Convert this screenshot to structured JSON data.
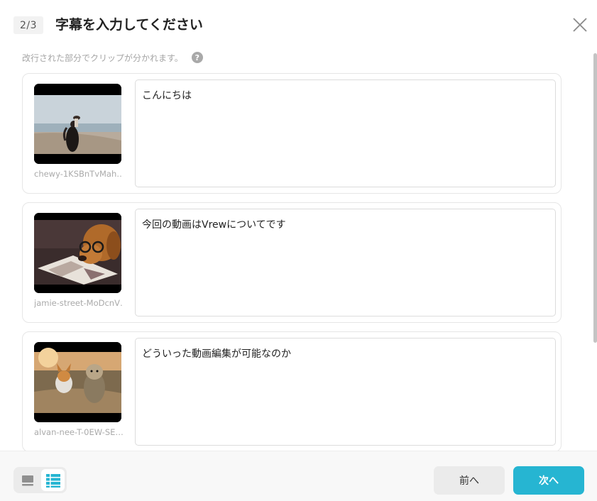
{
  "header": {
    "step": "2/3",
    "title": "字幕を入力してください"
  },
  "hint": {
    "text": "改行された部分でクリップが分かれます。",
    "help_glyph": "?"
  },
  "clips": [
    {
      "name": "chewy-1KSBnTvMah…",
      "caption": "こんにちは"
    },
    {
      "name": "jamie-street-MoDcnV…",
      "caption": "今回の動画はVrewについてです"
    },
    {
      "name": "alvan-nee-T-0EW-SE…",
      "caption": "どういった動画編集が可能なのか"
    }
  ],
  "footer": {
    "view_modes": [
      "single-view-icon",
      "list-view-icon"
    ],
    "active_view": "list-view-icon",
    "prev_label": "前へ",
    "next_label": "次へ"
  },
  "colors": {
    "accent": "#26b5d2",
    "secondary_button": "#ebebeb",
    "hint_text": "#a5a5a5"
  }
}
